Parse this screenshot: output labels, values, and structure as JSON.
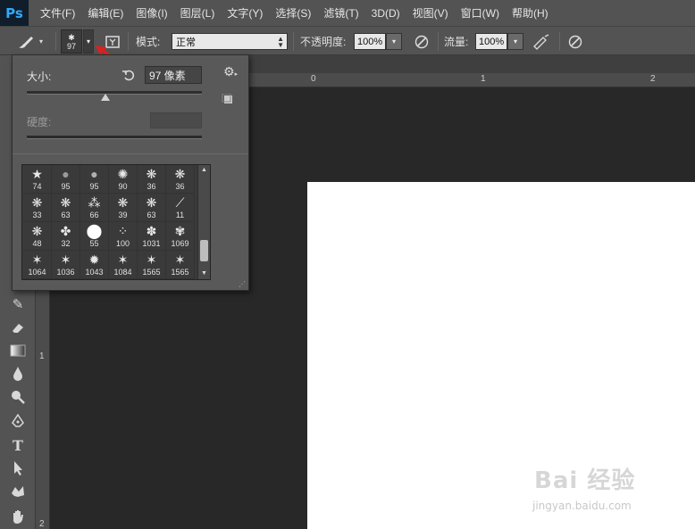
{
  "app": {
    "logo": "Ps"
  },
  "menu": [
    "文件(F)",
    "编辑(E)",
    "图像(I)",
    "图层(L)",
    "文字(Y)",
    "选择(S)",
    "滤镜(T)",
    "3D(D)",
    "视图(V)",
    "窗口(W)",
    "帮助(H)"
  ],
  "options": {
    "brush_size": "97",
    "mode_label": "模式:",
    "mode_value": "正常",
    "opacity_label": "不透明度:",
    "opacity_value": "100%",
    "flow_label": "流量:",
    "flow_value": "100%"
  },
  "popup": {
    "size_label": "大小:",
    "size_value": "97 像素",
    "size_level": 0.45,
    "hardness_label": "硬度:",
    "brushes": [
      "74",
      "95",
      "95",
      "90",
      "36",
      "36",
      "33",
      "63",
      "66",
      "39",
      "63",
      "11",
      "48",
      "32",
      "55",
      "100",
      "1031",
      "1069",
      "1064",
      "1036",
      "1043",
      "1084",
      "1565",
      "1565"
    ]
  },
  "ruler": {
    "h_labels": [
      "0",
      "1",
      "2"
    ],
    "v_labels": [
      "1",
      "2"
    ]
  },
  "watermark": {
    "logo": "Bai 经验",
    "url": "jingyan.baidu.com"
  },
  "colors": {
    "chrome": "#535353",
    "workspace": "#282828",
    "canvas": "#ffffff",
    "arrow": "#e02020"
  }
}
